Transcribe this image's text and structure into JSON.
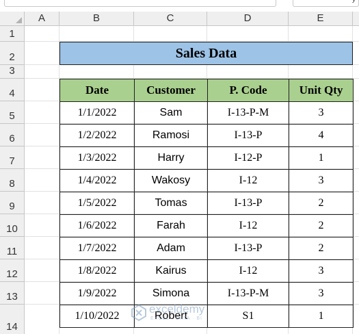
{
  "sheet": {
    "columns": [
      "A",
      "B",
      "C",
      "D",
      "E"
    ],
    "rows": [
      "1",
      "2",
      "3",
      "4",
      "5",
      "6",
      "7",
      "8",
      "9",
      "10",
      "11",
      "12",
      "13",
      "14"
    ],
    "formula_bar_right": "y"
  },
  "title": "Sales Data",
  "table": {
    "headers": [
      "Date",
      "Customer",
      "P. Code",
      "Unit Qty"
    ],
    "rows": [
      [
        "1/1/2022",
        "Sam",
        "I-13-P-M",
        "3"
      ],
      [
        "1/2/2022",
        "Ramosi",
        "I-13-P",
        "4"
      ],
      [
        "1/3/2022",
        "Harry",
        "I-12-P",
        "1"
      ],
      [
        "1/4/2022",
        "Wakosy",
        "I-12",
        "3"
      ],
      [
        "1/5/2022",
        "Tomas",
        "I-13-P",
        "2"
      ],
      [
        "1/6/2022",
        "Farah",
        "I-12",
        "2"
      ],
      [
        "1/7/2022",
        "Adam",
        "I-13-P",
        "2"
      ],
      [
        "1/8/2022",
        "Kairus",
        "I-12",
        "3"
      ],
      [
        "1/9/2022",
        "Simona",
        "I-13-P-M",
        "3"
      ],
      [
        "1/10/2022",
        "Robert",
        "S1",
        "1"
      ]
    ]
  },
  "watermark": {
    "name": "exceldemy",
    "tagline": "EXCEL · DATA · BI"
  },
  "colors": {
    "title_fill": "#9dc3e6",
    "header_fill": "#a9d08e",
    "sheet_header_bg": "#efefef"
  }
}
